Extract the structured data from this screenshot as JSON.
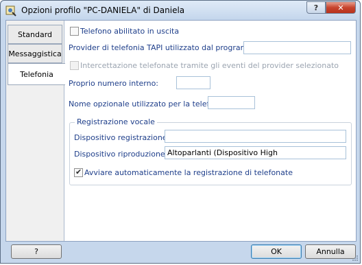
{
  "window": {
    "title": "Opzioni profilo \"PC-DANIELA\" di Daniela",
    "help_label": "?",
    "close_label": "✕"
  },
  "tabs": [
    {
      "label": "Standard"
    },
    {
      "label": "Messaggistica"
    },
    {
      "label": "Telefonia"
    }
  ],
  "telefonia": {
    "phone_enabled": {
      "label": "Telefono abilitato in uscita",
      "checked": false
    },
    "provider_label": "Provider di telefonia TAPI utilizzato dal programma:",
    "provider_value": "",
    "intercept": {
      "label": "Intercettazione telefonate tramite gli eventi del provider selezionato",
      "checked": false,
      "disabled": true
    },
    "internal_number_label": "Proprio numero interno:",
    "internal_number_value": "",
    "optional_name_label": "Nome opzionale utilizzato per la telefonia:",
    "optional_name_value": ""
  },
  "recording": {
    "group_title": "Registrazione vocale",
    "record_device_label": "Dispositivo registrazione:",
    "record_device_value": "",
    "play_device_label": "Dispositivo riproduzione:",
    "play_device_value": "Altoparlanti (Dispositivo High",
    "auto_record": {
      "label": "Avviare automaticamente la registrazione di telefonate",
      "checked": true
    }
  },
  "footer": {
    "help_label": "?",
    "ok_label": "OK",
    "cancel_label": "Annulla"
  }
}
